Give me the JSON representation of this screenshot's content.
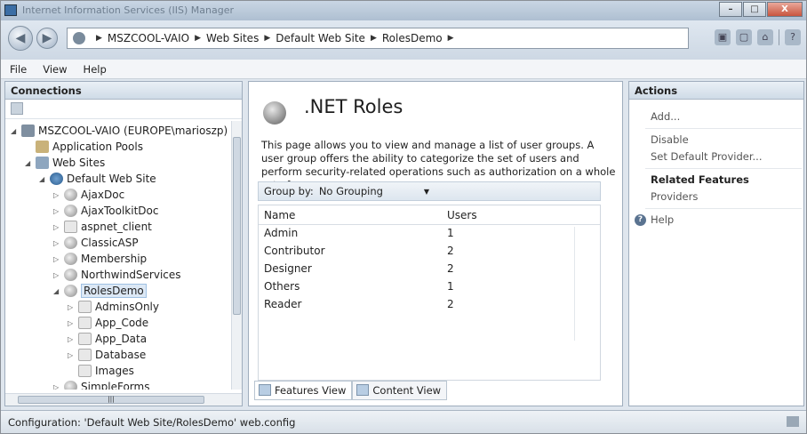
{
  "window": {
    "title": "Internet Information Services (IIS) Manager"
  },
  "address": {
    "crumbs": [
      "MSZCOOL-VAIO",
      "Web Sites",
      "Default Web Site",
      "RolesDemo"
    ]
  },
  "menu": {
    "items": [
      "File",
      "View",
      "Help"
    ]
  },
  "connections": {
    "title": "Connections",
    "tree": [
      {
        "label": "MSZCOOL-VAIO (EUROPE\\marioszp)",
        "icon": "server-icon",
        "indent": 0,
        "expander": "expanded"
      },
      {
        "label": "Application Pools",
        "icon": "app-pools-icon",
        "indent": 1,
        "expander": ""
      },
      {
        "label": "Web Sites",
        "icon": "web-sites-icon",
        "indent": 1,
        "expander": "expanded"
      },
      {
        "label": "Default Web Site",
        "icon": "globe-icon",
        "indent": 2,
        "expander": "expanded"
      },
      {
        "label": "AjaxDoc",
        "icon": "application-icon",
        "indent": 3,
        "expander": "collapsed"
      },
      {
        "label": "AjaxToolkitDoc",
        "icon": "application-icon",
        "indent": 3,
        "expander": "collapsed"
      },
      {
        "label": "aspnet_client",
        "icon": "folder-icon",
        "indent": 3,
        "expander": "collapsed"
      },
      {
        "label": "ClassicASP",
        "icon": "application-icon",
        "indent": 3,
        "expander": "collapsed"
      },
      {
        "label": "Membership",
        "icon": "application-icon",
        "indent": 3,
        "expander": "collapsed"
      },
      {
        "label": "NorthwindServices",
        "icon": "application-icon",
        "indent": 3,
        "expander": "collapsed"
      },
      {
        "label": "RolesDemo",
        "icon": "application-icon",
        "indent": 3,
        "expander": "expanded",
        "selected": true
      },
      {
        "label": "AdminsOnly",
        "icon": "folder-icon",
        "indent": 4,
        "expander": "collapsed"
      },
      {
        "label": "App_Code",
        "icon": "folder-icon",
        "indent": 4,
        "expander": "collapsed"
      },
      {
        "label": "App_Data",
        "icon": "folder-icon",
        "indent": 4,
        "expander": "collapsed"
      },
      {
        "label": "Database",
        "icon": "folder-icon",
        "indent": 4,
        "expander": "collapsed"
      },
      {
        "label": "Images",
        "icon": "folder-icon",
        "indent": 4,
        "expander": ""
      },
      {
        "label": "SimpleForms",
        "icon": "application-icon",
        "indent": 3,
        "expander": "collapsed"
      }
    ]
  },
  "main": {
    "title": ".NET Roles",
    "description": "This page allows you to view and manage a list of user groups. A user group offers the ability to categorize the set of users and perform security-related operations such as authorization on a whole set of users.",
    "group_by_label": "Group by:",
    "group_by_value": "No Grouping",
    "columns": [
      "Name",
      "Users"
    ],
    "rows": [
      {
        "name": "Admin",
        "users": "1"
      },
      {
        "name": "Contributor",
        "users": "2"
      },
      {
        "name": "Designer",
        "users": "2"
      },
      {
        "name": "Others",
        "users": "1"
      },
      {
        "name": "Reader",
        "users": "2"
      }
    ],
    "tabs": {
      "features": "Features View",
      "content": "Content View"
    }
  },
  "actions": {
    "title": "Actions",
    "add": "Add...",
    "disable": "Disable",
    "set_default_provider": "Set Default Provider...",
    "related_features": "Related Features",
    "providers": "Providers",
    "help": "Help"
  },
  "status": {
    "text": "Configuration: 'Default Web Site/RolesDemo' web.config"
  }
}
